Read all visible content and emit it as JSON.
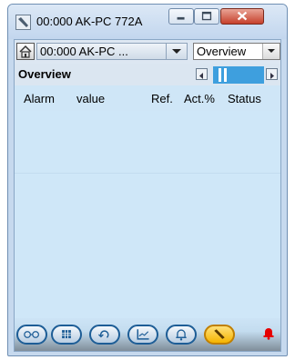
{
  "window": {
    "title": "00:000 AK-PC 772A",
    "icons": [
      "app-wrench-icon",
      "minimize-icon",
      "maximize-icon",
      "close-icon"
    ]
  },
  "toolbar": {
    "home_icon": "home-icon",
    "device_select_value": "00:000 AK-PC ...",
    "view_select_value": "Overview"
  },
  "view": {
    "title": "Overview",
    "pager_icons": [
      "prev-page-icon",
      "next-page-icon"
    ]
  },
  "columns": [
    "Alarm",
    "value",
    "Ref.",
    "Act.%",
    "Status"
  ],
  "bottom_bar": {
    "buttons": [
      "glasses-icon",
      "keypad-icon",
      "refresh-icon",
      "graph-icon",
      "alarm-bell-icon",
      "wrench-icon"
    ],
    "active": "wrench-icon",
    "status_icon": "alarm-status-icon",
    "colors": {
      "active": "#f5b400",
      "border": "#1d5d96",
      "alarm": "#e60000"
    }
  }
}
